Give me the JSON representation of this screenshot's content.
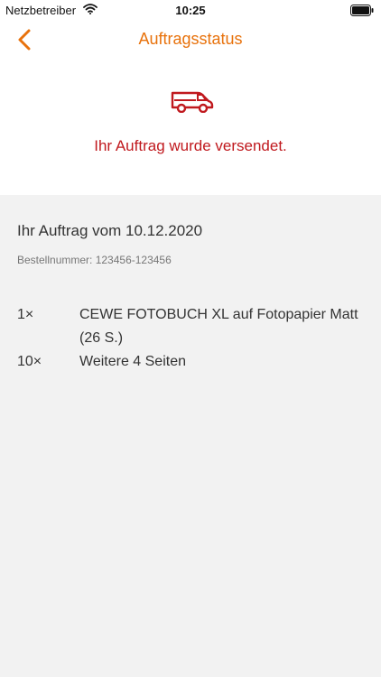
{
  "status_bar": {
    "carrier": "Netzbetreiber",
    "time": "10:25",
    "icons": [
      "wifi-icon",
      "battery-icon"
    ]
  },
  "nav": {
    "back_icon": "chevron-left-icon",
    "title": "Auftragsstatus"
  },
  "status": {
    "icon": "delivery-van-icon",
    "message": "Ihr Auftrag wurde versendet."
  },
  "order": {
    "heading": "Ihr Auftrag vom 10.12.2020",
    "number_label": "Bestellnummer: 123456-123456",
    "items": [
      {
        "qty": "1×",
        "name": "CEWE FOTOBUCH XL auf Fotopapier Matt (26 S.)"
      },
      {
        "qty": "10×",
        "name": "Weitere 4 Seiten"
      }
    ]
  },
  "colors": {
    "accent": "#e8720c",
    "status": "#c0191e",
    "background": "#f2f2f2"
  }
}
